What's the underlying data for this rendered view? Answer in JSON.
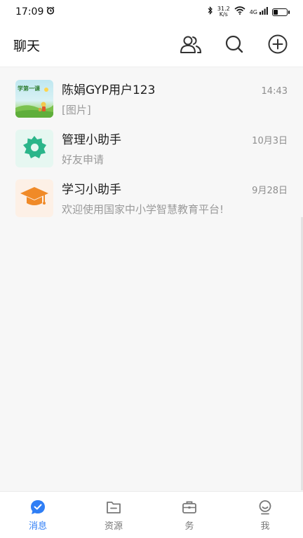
{
  "status_bar": {
    "time": "17:09",
    "net_speed_value": "31.2",
    "net_speed_unit": "K/s",
    "signal_label": "4G",
    "battery_level": 0.35
  },
  "header": {
    "title": "聊天",
    "actions": [
      "contacts-icon",
      "search-icon",
      "add-icon"
    ]
  },
  "chats": [
    {
      "name": "陈娟GYP用户123",
      "preview": "[图片]",
      "time": "14:43",
      "avatar": "thumbnail",
      "avatar_text": "学第一课"
    },
    {
      "name": "管理小助手",
      "preview": "好友申请",
      "time": "10月3日",
      "avatar": "gear-icon"
    },
    {
      "name": "学习小助手",
      "preview": "欢迎使用国家中小学智慧教育平台!",
      "time": "9月28日",
      "avatar": "graduation-cap-icon"
    }
  ],
  "bottom_nav": {
    "items": [
      {
        "label": "消息",
        "icon": "message-icon",
        "active": true
      },
      {
        "label": "资源",
        "icon": "folder-icon",
        "active": false
      },
      {
        "label": "务",
        "icon": "briefcase-icon",
        "active": false
      },
      {
        "label": "我",
        "icon": "profile-icon",
        "active": false
      }
    ]
  },
  "colors": {
    "accent": "#2f7ef5",
    "gear_green": "#2bb58a",
    "gear_bg": "#e6f7f1",
    "cap_orange": "#f08a28",
    "cap_bg": "#fdf0e6"
  }
}
